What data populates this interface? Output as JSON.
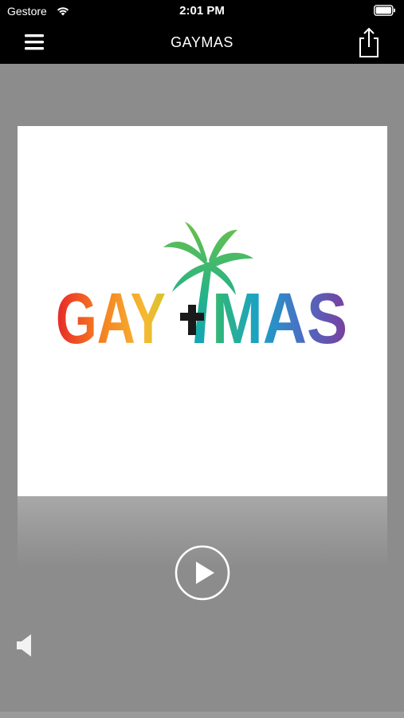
{
  "status_bar": {
    "carrier": "Gestore",
    "time": "2:01 PM",
    "wifi_icon": "wifi-icon",
    "battery_icon": "battery-icon"
  },
  "nav": {
    "title": "GAYMAS",
    "menu_icon": "hamburger-menu-icon",
    "share_icon": "share-icon"
  },
  "artwork": {
    "logo_text": "GAY+MAS",
    "logo_icon": "palm-tree-icon"
  },
  "player": {
    "play_icon": "play-icon",
    "volume_icon": "speaker-icon"
  },
  "colors": {
    "background": "#8c8c8c",
    "bar": "#000000",
    "artwork_bg": "#ffffff"
  }
}
